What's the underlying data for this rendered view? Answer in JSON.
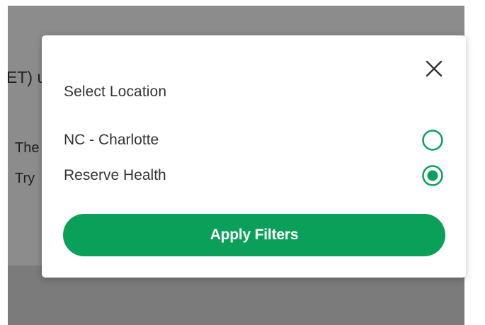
{
  "background": {
    "heading_fragment": "ET) u",
    "line1_fragment": "The",
    "line2_fragment": "Try "
  },
  "modal": {
    "title": "Select Location",
    "close_icon": "close-icon",
    "options": [
      {
        "label": "NC - Charlotte",
        "selected": false
      },
      {
        "label": "Reserve Health",
        "selected": true
      }
    ],
    "apply_label": "Apply Filters"
  },
  "colors": {
    "accent": "#0ba05a",
    "overlay": "#8c8c8c",
    "text": "#333333"
  }
}
